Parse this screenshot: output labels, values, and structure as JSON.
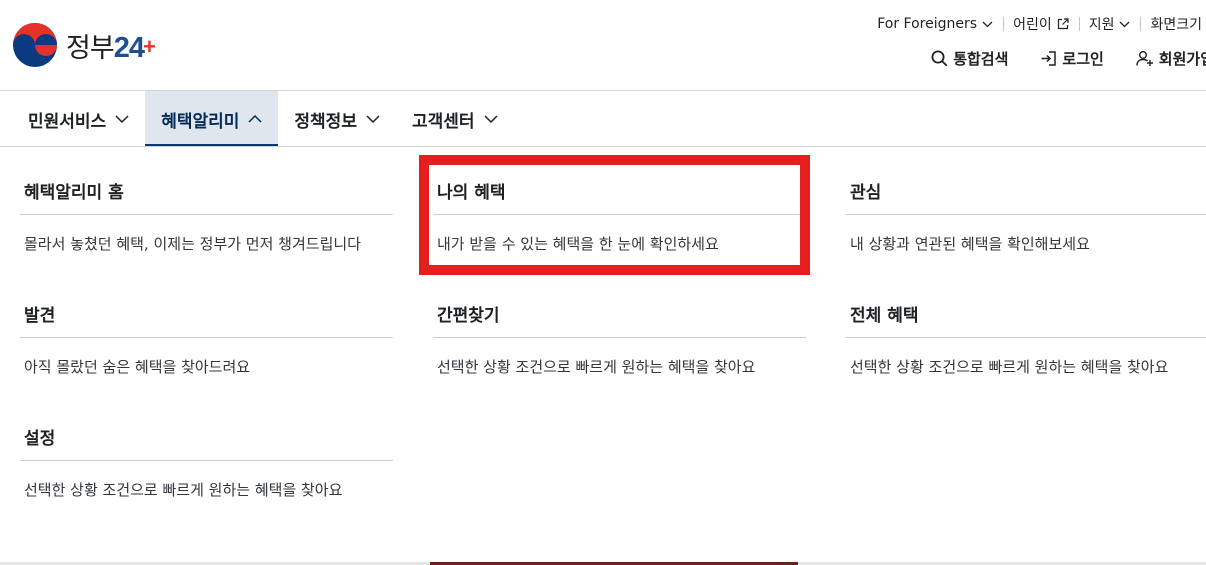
{
  "logo": {
    "text": "정부",
    "num": "24",
    "plus": "+"
  },
  "utility": [
    {
      "label": "For Foreigners",
      "icon": "chevron-down-icon"
    },
    {
      "label": "어린이",
      "icon": "external-link-icon"
    },
    {
      "label": "지원",
      "icon": "chevron-down-icon"
    },
    {
      "label": "화면크기",
      "icon": ""
    }
  ],
  "actions": {
    "search": "통합검색",
    "login": "로그인",
    "signup": "회원가입"
  },
  "gnb": [
    {
      "label": "민원서비스",
      "expanded": false
    },
    {
      "label": "혜택알리미",
      "expanded": true
    },
    {
      "label": "정책정보",
      "expanded": false
    },
    {
      "label": "고객센터",
      "expanded": false
    }
  ],
  "menu": {
    "home": {
      "title": "혜택알리미 홈",
      "desc": "몰라서 놓쳤던 혜택, 이제는 정부가 먼저 챙겨드립니다"
    },
    "mine": {
      "title": "나의 혜택",
      "desc": "내가 받을 수 있는 혜택을 한 눈에 확인하세요"
    },
    "interest": {
      "title": "관심",
      "desc": "내 상황과 연관된 혜택을 확인해보세요"
    },
    "discover": {
      "title": "발견",
      "desc": "아직 몰랐던 숨은 혜택을 찾아드려요"
    },
    "quick": {
      "title": "간편찾기",
      "desc": "선택한 상황 조건으로 빠르게 원하는 혜택을 찾아요"
    },
    "all": {
      "title": "전체 혜택",
      "desc": "선택한 상황 조건으로 빠르게 원하는 혜택을 찾아요"
    },
    "settings": {
      "title": "설정",
      "desc": "선택한 상황 조건으로 빠르게 원하는 혜택을 찾아요"
    }
  },
  "colors": {
    "brand_navy": "#063a74",
    "active_tab_bg": "#dfe6ee",
    "highlight": "#e51e1e",
    "logo_red": "#e4322b",
    "logo_blue": "#1d4f91"
  }
}
